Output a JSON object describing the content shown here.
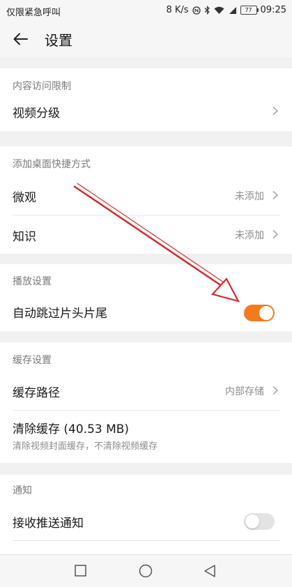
{
  "status_bar": {
    "carrier": "仅限紧急呼叫",
    "speed": "8 K/s",
    "battery": "77",
    "time": "09:25"
  },
  "header": {
    "title": "设置"
  },
  "sections": {
    "content_restriction": {
      "header": "内容访问限制",
      "video_rating_label": "视频分级"
    },
    "shortcuts": {
      "header": "添加桌面快捷方式",
      "weiguan_label": "微观",
      "weiguan_value": "未添加",
      "zhishi_label": "知识",
      "zhishi_value": "未添加"
    },
    "playback": {
      "header": "播放设置",
      "skip_label": "自动跳过片头片尾",
      "skip_on": true
    },
    "cache": {
      "header": "缓存设置",
      "path_label": "缓存路径",
      "path_value": "内部存储",
      "clear_label": "清除缓存 (40.53 MB)",
      "clear_desc": "清除视频封面缓存，不清除视频缓存"
    },
    "notification": {
      "header": "通知",
      "push_label": "接收推送通知",
      "push_on": false
    }
  },
  "colors": {
    "accent": "#f27c1d",
    "annotation_arrow": "#d42a2a",
    "toggle_off": "#e3e3e3"
  },
  "icons": [
    "back-arrow-icon",
    "chevron-right-icon",
    "recent-apps-icon",
    "home-icon",
    "back-triangle-icon"
  ]
}
